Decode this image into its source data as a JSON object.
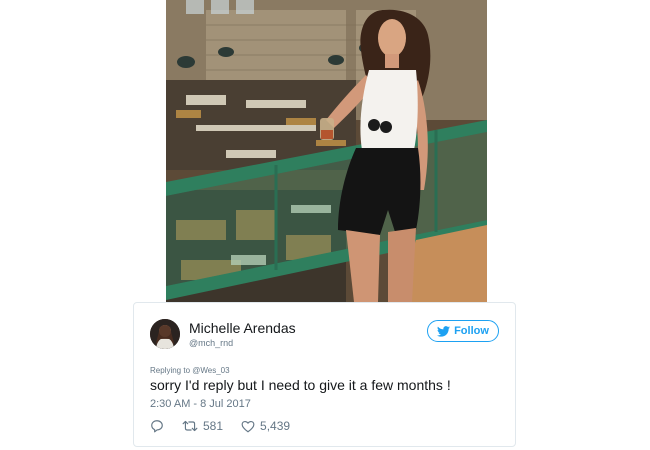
{
  "photo": {
    "icon": "photo-woman-in-market"
  },
  "tweet": {
    "display_name": "Michelle Arendas",
    "handle": "@mch_rnd",
    "follow_label": "Follow",
    "replying_to": "Replying to @Wes_03",
    "text": "sorry I'd reply but I need to give it a few months !",
    "timestamp": "2:30 AM - 8 Jul 2017",
    "retweets": "581",
    "likes": "5,439"
  },
  "colors": {
    "twitter_blue": "#1da1f2",
    "text": "#14171a",
    "muted": "#657786",
    "border": "#e1e8ed"
  },
  "icons": {
    "follow": "twitter-bird-icon",
    "reply": "reply-icon",
    "retweet": "retweet-icon",
    "like": "heart-icon"
  }
}
